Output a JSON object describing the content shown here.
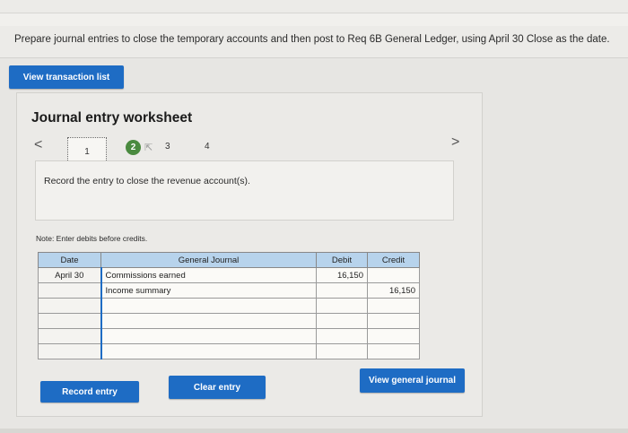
{
  "instruction": "Prepare journal entries to close the temporary accounts and then post to Req 6B General Ledger, using April 30 Close as the date.",
  "buttons": {
    "view_transaction_list": "View transaction list",
    "record_entry": "Record entry",
    "clear_entry": "Clear entry",
    "view_general_journal": "View general journal"
  },
  "worksheet": {
    "title": "Journal entry worksheet",
    "nav_prev": "<",
    "nav_next": ">",
    "steps": [
      "1",
      "2",
      "3",
      "4"
    ],
    "current_step": "2",
    "description": "Record the entry to close the revenue account(s).",
    "note": "Note: Enter debits before credits."
  },
  "journal": {
    "headers": [
      "Date",
      "General Journal",
      "Debit",
      "Credit"
    ],
    "rows": [
      {
        "date": "April 30",
        "account": "Commissions earned",
        "debit": "16,150",
        "credit": ""
      },
      {
        "date": "",
        "account": "Income summary",
        "debit": "",
        "credit": "16,150"
      },
      {
        "date": "",
        "account": "",
        "debit": "",
        "credit": ""
      },
      {
        "date": "",
        "account": "",
        "debit": "",
        "credit": ""
      },
      {
        "date": "",
        "account": "",
        "debit": "",
        "credit": ""
      },
      {
        "date": "",
        "account": "",
        "debit": "",
        "credit": ""
      }
    ]
  },
  "colors": {
    "button_blue": "#1e6cc4",
    "step_active_green": "#4a8a3f",
    "table_header": "#b7d3ec"
  }
}
